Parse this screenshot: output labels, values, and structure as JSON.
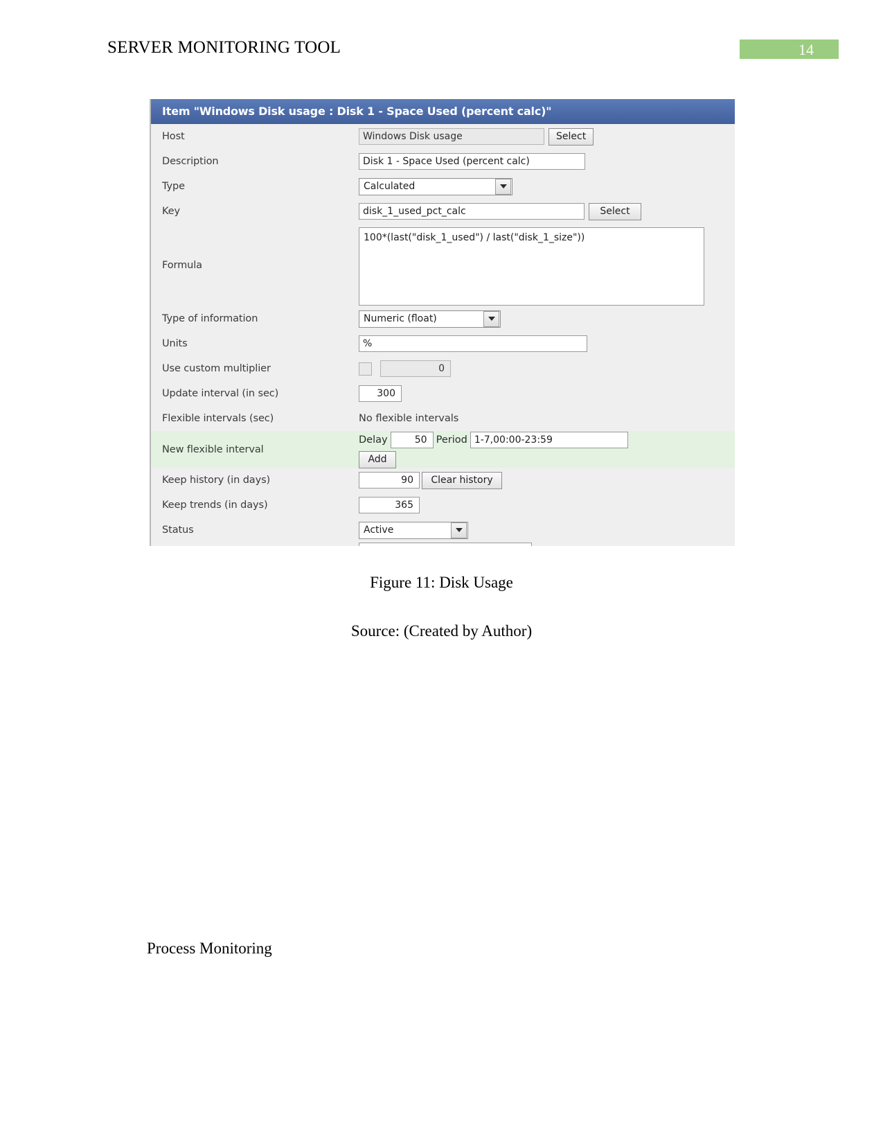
{
  "header": {
    "title": "SERVER MONITORING TOOL",
    "page_number": "14",
    "badge_color": "#9ACD7F"
  },
  "screenshot": {
    "window_title": "Item \"Windows Disk usage : Disk 1 - Space Used (percent calc)\"",
    "titlebar_color": "#4c6ba8",
    "highlight_row_color": "#e3f2e1",
    "rows": {
      "host": {
        "label": "Host",
        "value": "Windows Disk usage",
        "button": "Select"
      },
      "description": {
        "label": "Description",
        "value": "Disk 1 - Space Used (percent calc)"
      },
      "type": {
        "label": "Type",
        "value": "Calculated"
      },
      "key": {
        "label": "Key",
        "value": "disk_1_used_pct_calc",
        "button": "Select"
      },
      "formula": {
        "label": "Formula",
        "value": "100*(last(\"disk_1_used\") / last(\"disk_1_size\"))"
      },
      "type_of_information": {
        "label": "Type of information",
        "value": "Numeric (float)"
      },
      "units": {
        "label": "Units",
        "value": "%"
      },
      "use_custom_multiplier": {
        "label": "Use custom multiplier",
        "checked": false,
        "value": "0"
      },
      "update_interval": {
        "label": "Update interval (in sec)",
        "value": "300"
      },
      "flexible_intervals": {
        "label": "Flexible intervals (sec)",
        "value": "No flexible intervals"
      },
      "new_flexible_interval": {
        "label": "New flexible interval",
        "delay_label": "Delay",
        "delay_value": "50",
        "period_label": "Period",
        "period_value": "1-7,00:00-23:59",
        "add_button": "Add"
      },
      "keep_history": {
        "label": "Keep history (in days)",
        "value": "90",
        "button": "Clear history"
      },
      "keep_trends": {
        "label": "Keep trends (in days)",
        "value": "365"
      },
      "status": {
        "label": "Status",
        "value": "Active"
      }
    }
  },
  "figure_caption": "Figure 11: Disk Usage",
  "source_caption": "Source: (Created by Author)",
  "body_text": "Process Monitoring"
}
